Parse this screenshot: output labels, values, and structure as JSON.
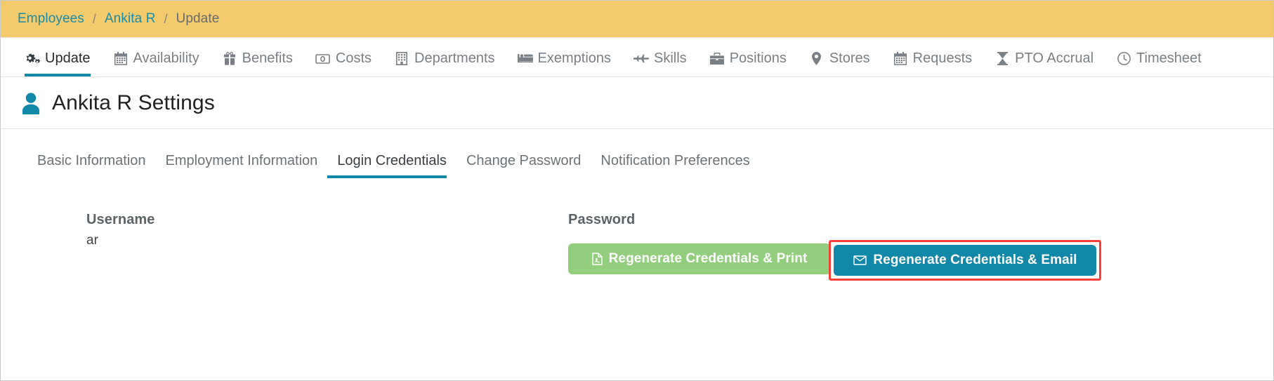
{
  "breadcrumb": {
    "items": [
      {
        "label": "Employees",
        "current": false
      },
      {
        "label": "Ankita R",
        "current": false
      },
      {
        "label": "Update",
        "current": true
      }
    ],
    "separator": "/",
    "background_color": "#f3cb6d",
    "link_color": "#1a8ca8"
  },
  "tabs": {
    "active_index": 0,
    "accent_color": "#1288a8",
    "items": [
      {
        "label": "Update",
        "icon": "gears-icon"
      },
      {
        "label": "Availability",
        "icon": "calendar-icon"
      },
      {
        "label": "Benefits",
        "icon": "gift-icon"
      },
      {
        "label": "Costs",
        "icon": "money-bill-icon"
      },
      {
        "label": "Departments",
        "icon": "building-icon"
      },
      {
        "label": "Exemptions",
        "icon": "bed-icon"
      },
      {
        "label": "Skills",
        "icon": "fighter-jet-icon"
      },
      {
        "label": "Positions",
        "icon": "briefcase-icon"
      },
      {
        "label": "Stores",
        "icon": "map-marker-icon"
      },
      {
        "label": "Requests",
        "icon": "calendar-icon"
      },
      {
        "label": "PTO Accrual",
        "icon": "hourglass-icon"
      },
      {
        "label": "Timesheet",
        "icon": "clock-icon"
      }
    ]
  },
  "page_header": {
    "title": "Ankita R Settings",
    "icon": "user-icon",
    "icon_color": "#1288a8"
  },
  "subtabs": {
    "active_index": 2,
    "accent_color": "#1288a8",
    "items": [
      {
        "label": "Basic Information"
      },
      {
        "label": "Employment Information"
      },
      {
        "label": "Login Credentials"
      },
      {
        "label": "Change Password"
      },
      {
        "label": "Notification Preferences"
      }
    ]
  },
  "form": {
    "username": {
      "label": "Username",
      "value": "ar"
    },
    "password": {
      "label": "Password",
      "print_button": {
        "label": "Regenerate Credentials & Print",
        "icon": "file-pdf-icon",
        "color": "#93ce7e"
      },
      "email_button": {
        "label": "Regenerate Credentials & Email",
        "icon": "envelope-icon",
        "color": "#1288a8",
        "highlighted": true,
        "highlight_color": "#f5403c"
      }
    }
  }
}
